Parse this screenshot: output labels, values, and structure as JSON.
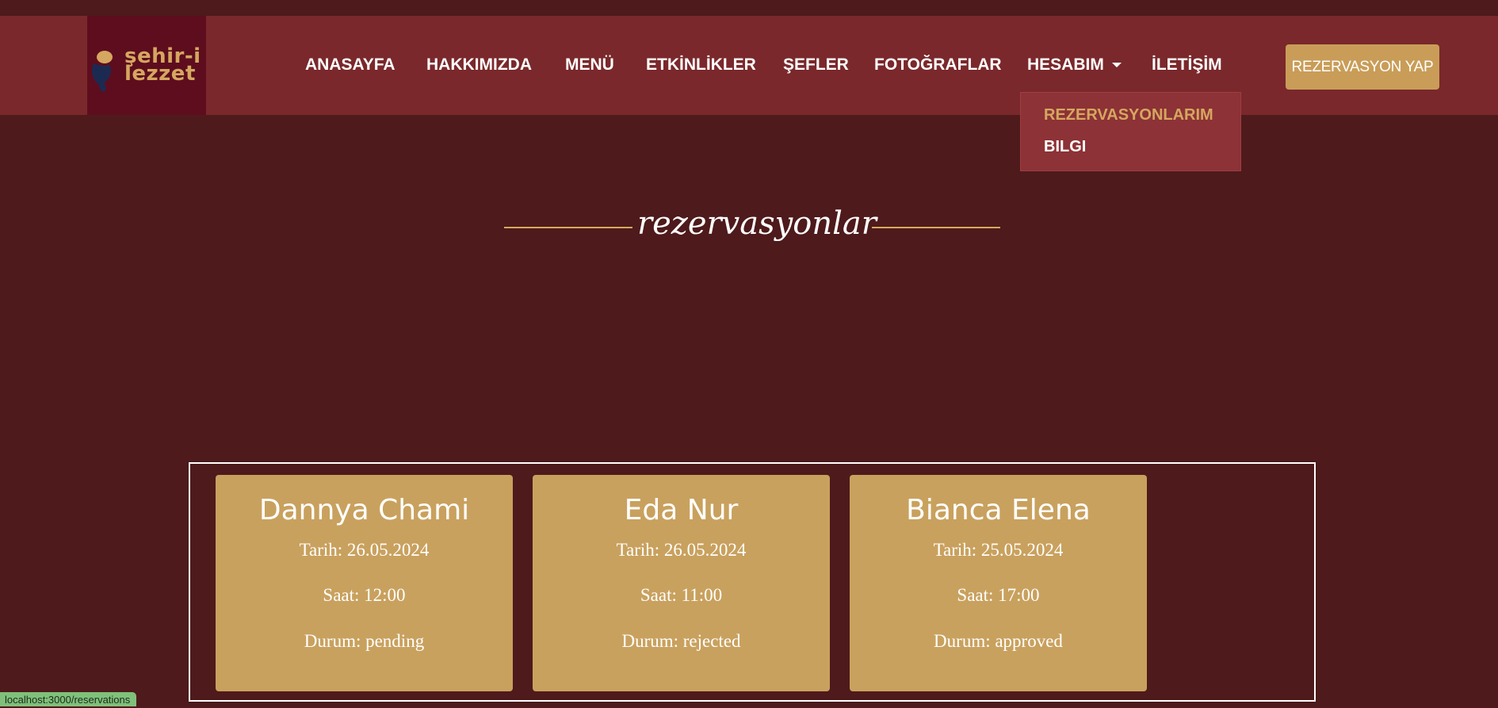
{
  "brand": {
    "logo_line1": "şehir-i",
    "logo_line2": "lezzet"
  },
  "nav": {
    "items": [
      "ANASAYFA",
      "HAKKIMIZDA",
      "MENÜ",
      "ETKİNLİKLER",
      "ŞEFLER",
      "FOTOĞRAFLAR",
      "HESABIM",
      "İLETİŞİM"
    ],
    "dropdown": {
      "active": "REZERVASYONLARIM",
      "info": "BILGI"
    },
    "cta": "REZERVASYON YAP"
  },
  "page": {
    "heading": "rezervasyonlar"
  },
  "reservations": [
    {
      "name": "Dannya Chami",
      "date": "Tarih: 26.05.2024",
      "time": "Saat: 12:00",
      "status": "Durum: pending"
    },
    {
      "name": "Eda Nur",
      "date": "Tarih: 26.05.2024",
      "time": "Saat: 11:00",
      "status": "Durum: rejected"
    },
    {
      "name": "Bianca Elena",
      "date": "Tarih: 25.05.2024",
      "time": "Saat: 17:00",
      "status": "Durum: approved"
    }
  ],
  "status_bar": {
    "url": "localhost:3000/reservations"
  },
  "colors": {
    "background": "#4e1a1b",
    "navbar": "#7a282b",
    "accent": "#c99d58",
    "logo_bg": "#5e0d1e"
  }
}
